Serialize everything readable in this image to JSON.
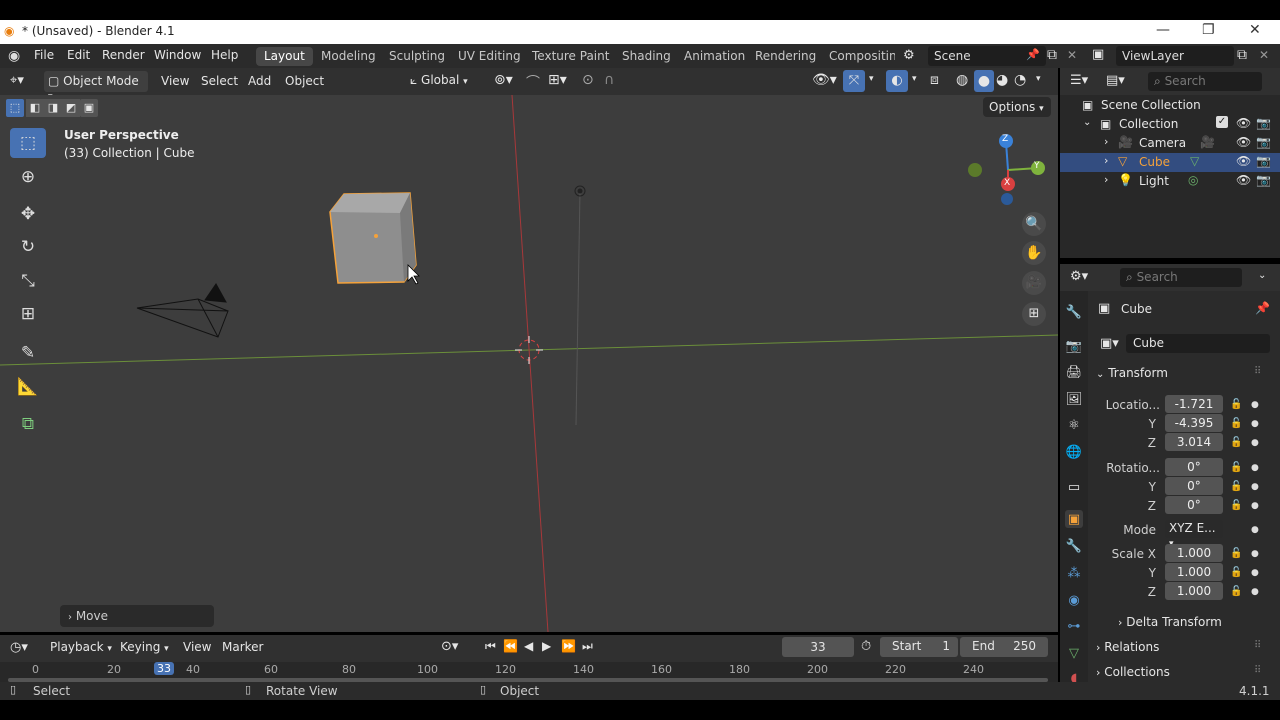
{
  "window": {
    "title": "* (Unsaved) - Blender 4.1",
    "min_icon": "minimize-icon",
    "max_icon": "restore-icon",
    "close_icon": "close-icon"
  },
  "menu": [
    "File",
    "Edit",
    "Render",
    "Window",
    "Help"
  ],
  "workspaces": [
    "Layout",
    "Modeling",
    "Sculpting",
    "UV Editing",
    "Texture Paint",
    "Shading",
    "Animation",
    "Rendering",
    "Compositing"
  ],
  "active_workspace": "Layout",
  "scene": "Scene",
  "view_layer": "ViewLayer",
  "viewport_header": {
    "mode": "Object Mode",
    "menus": [
      "View",
      "Select",
      "Add",
      "Object"
    ],
    "orientation": "Global",
    "options": "Options"
  },
  "viewport": {
    "perspective": "User Perspective",
    "collection_info": "(33) Collection | Cube",
    "last_op": "Move",
    "gizmo": {
      "z": "Z",
      "y": "Y",
      "x": "X"
    }
  },
  "outliner": {
    "search_placeholder": "Search",
    "root": "Scene Collection",
    "collection": "Collection",
    "items": [
      {
        "label": "Camera",
        "icon": "camera-icon"
      },
      {
        "label": "Cube",
        "icon": "mesh-icon",
        "selected": true
      },
      {
        "label": "Light",
        "icon": "light-icon"
      }
    ]
  },
  "properties": {
    "search_placeholder": "Search",
    "object_name": "Cube",
    "data_name": "Cube",
    "transform_label": "Transform",
    "location_label": "Locatio...",
    "location": [
      "-1.721",
      "-4.395",
      "3.014"
    ],
    "rotation_label": "Rotatio...",
    "rotation": [
      "0°",
      "0°",
      "0°"
    ],
    "mode_label": "Mode",
    "mode_value": "XYZ E...",
    "scale_label": "Scale X",
    "scale": [
      "1.000",
      "1.000",
      "1.000"
    ],
    "axis_y": "Y",
    "axis_z": "Z",
    "delta_transform": "Delta Transform",
    "relations": "Relations",
    "collections": "Collections"
  },
  "timeline": {
    "menus": [
      "Playback",
      "Keying",
      "View",
      "Marker"
    ],
    "current_frame": "33",
    "start_label": "Start",
    "start": "1",
    "end_label": "End",
    "end": "250",
    "ruler": [
      "0",
      "20",
      "33",
      "40",
      "60",
      "80",
      "100",
      "120",
      "140",
      "160",
      "180",
      "200",
      "220",
      "240"
    ]
  },
  "statusbar": {
    "select": "Select",
    "rotate": "Rotate View",
    "object": "Object",
    "version": "4.1.1"
  },
  "colors": {
    "accent": "#4772b3",
    "selection": "#f5a23a",
    "x_axis": "#d94040",
    "y_axis": "#7fb33d",
    "z_axis": "#3a82d9"
  }
}
